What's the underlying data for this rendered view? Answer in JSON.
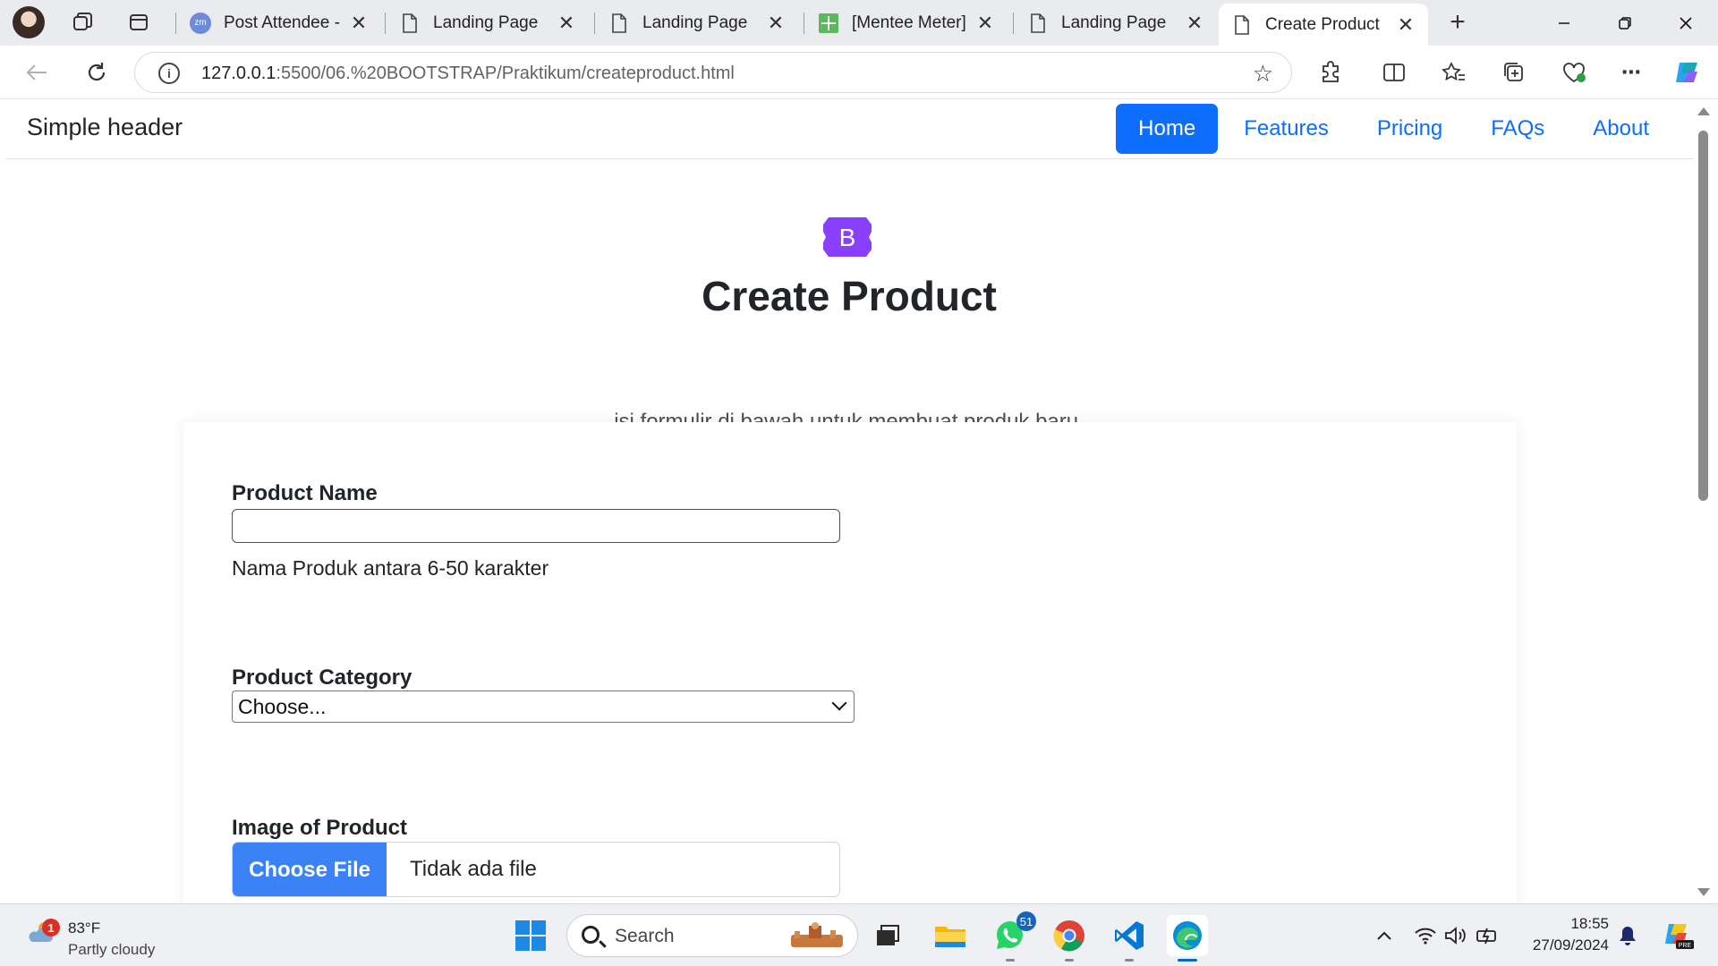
{
  "browser": {
    "tabs": [
      {
        "title": "Post Attendee - Zoom",
        "favicon": "zoom-icon"
      },
      {
        "title": "Landing Page",
        "favicon": "page-icon"
      },
      {
        "title": "Landing Page",
        "favicon": "page-icon"
      },
      {
        "title": "[Mentee Meter] R",
        "favicon": "sheets-icon"
      },
      {
        "title": "Landing Page",
        "favicon": "page-icon"
      },
      {
        "title": "Create Product",
        "favicon": "page-icon",
        "active": true
      }
    ],
    "url_host": "127.0.0.1",
    "url_rest": ":5500/06.%20BOOTSTRAP/Praktikum/createproduct.html"
  },
  "page": {
    "brand": "Simple header",
    "nav": [
      "Home",
      "Features",
      "Pricing",
      "FAQs",
      "About"
    ],
    "logo_letter": "B",
    "title": "Create Product",
    "lead": "isi formulir di bawah untuk membuat produk baru.",
    "form": {
      "product_name_label": "Product Name",
      "product_name_value": "",
      "product_name_help": "Nama Produk antara 6-50 karakter",
      "category_label": "Product Category",
      "category_selected": "Choose...",
      "image_label": "Image of Product",
      "file_button": "Choose File",
      "file_status": "Tidak ada file"
    }
  },
  "taskbar": {
    "weather_temp": "83°F",
    "weather_desc": "Partly cloudy",
    "weather_badge": "1",
    "search_placeholder": "Search",
    "whatsapp_badge": "51",
    "time": "18:55",
    "date": "27/09/2024"
  },
  "colors": {
    "primary": "#0d6efd",
    "bootstrap_purple": "#7952b3",
    "file_button": "#3b82f6"
  }
}
